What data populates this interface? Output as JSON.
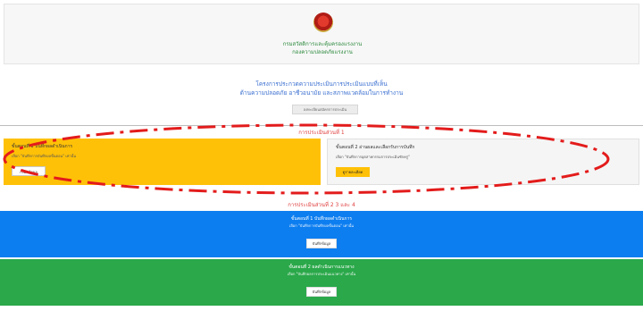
{
  "header": {
    "org_line1": "กรมสวัสดิการและคุ้มครองแรงงาน",
    "org_line2": "กองความปลอดภัยแรงงาน"
  },
  "project": {
    "line1": "โครงการประกวดความประเมินการประเมินแบบที่เห็น",
    "line2": "ด้านความปลอดภัย อาชีวอนามัย และสภาพแวดล้อมในการทำงาน",
    "action_label": "ลงทะเบียนสมัครการประเมิน"
  },
  "section1": {
    "title": "การประเมินส่วนที่ 1",
    "card_left": {
      "title": "ขั้นตอนที่ 1 บันทึกผลดำเนินการ",
      "subtitle": "เลือก \"บันทึกการบันทึกผลขั้นตอน\" เท่านั้น",
      "button": "กรอกข้อมูล"
    },
    "card_right": {
      "title": "ขั้นตอนที่ 2 อ่านผลและเลือกรับการบันทึก",
      "subtitle": "เลือก \"บันทึกการอุตสาหกรรมการประเมินซักครู่\"",
      "button": "ดูรายละเอียด"
    }
  },
  "section2": {
    "title": "การประเมินส่วนที่ 2 3 และ 4",
    "blue": {
      "title": "ขั้นตอนที่ 1 บันทึกผลดำเนินการ",
      "subtitle": "เลือก \"บันทึกการบันทึกผลขั้นตอน\" เท่านั้น",
      "button": "บันทึกข้อมูล"
    },
    "green": {
      "title": "ขั้นตอนที่ 2 ผลดำเนินการแนวทาง",
      "subtitle": "เลือก \"บันทึกผลการประเมินแนวทาง\" เท่านั้น",
      "button": "บันทึกข้อมูล"
    }
  },
  "colors": {
    "yellow": "#ffc107",
    "blue": "#0d7ef0",
    "green": "#2aa84a",
    "red_text": "#e04040",
    "annotation": "#e31b1b"
  },
  "icons": {
    "logo": "department-seal"
  }
}
